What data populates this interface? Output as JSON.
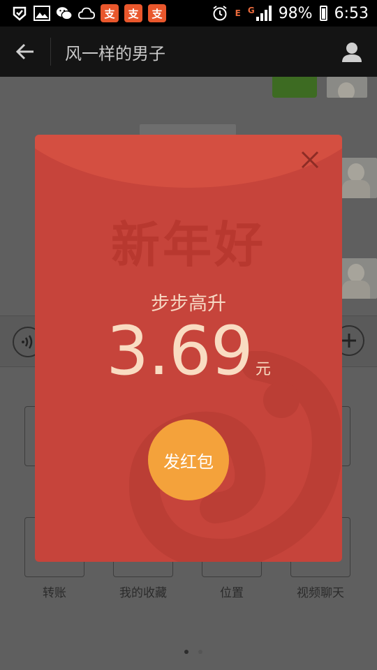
{
  "status_bar": {
    "battery": "98%",
    "time": "6:53",
    "app_badge_char": "支",
    "network_letters": [
      "E",
      "G"
    ]
  },
  "header": {
    "title": "风一样的男子"
  },
  "attachment_tools": [
    {
      "label": "转账"
    },
    {
      "label": "我的收藏"
    },
    {
      "label": "位置"
    },
    {
      "label": "视频聊天"
    }
  ],
  "red_packet": {
    "greeting": "新年好",
    "wish": "步步高升",
    "amount": "3.69",
    "unit": "元",
    "send_label": "发红包",
    "colors": {
      "body": "#c6443b",
      "top_flap": "#d44f41",
      "button": "#f4a23b"
    }
  },
  "icons": [
    "back-arrow-icon",
    "person-icon",
    "close-icon",
    "voice-icon",
    "plus-icon",
    "alarm-icon",
    "wechat-icon",
    "cloud-icon",
    "gallery-icon"
  ]
}
